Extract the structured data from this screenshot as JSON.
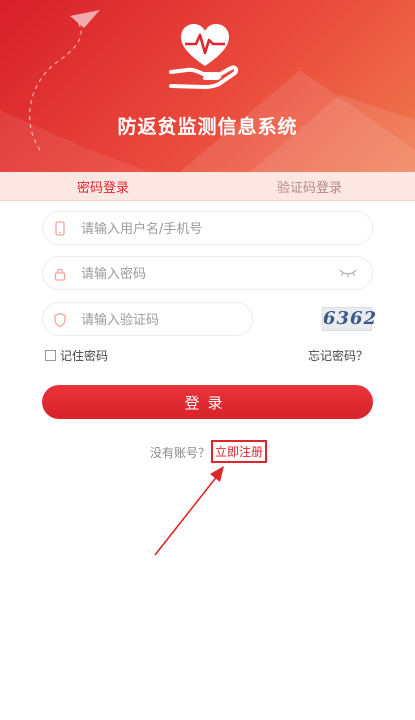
{
  "header": {
    "title": "防返贫监测信息系统",
    "logo_icon": "heart-in-hand-icon",
    "bg_colors": [
      "#d81f2a",
      "#f07a4e"
    ]
  },
  "tabs": [
    {
      "label": "密码登录",
      "active": true
    },
    {
      "label": "验证码登录",
      "active": false
    }
  ],
  "form": {
    "username_placeholder": "请输入用户名/手机号",
    "password_placeholder": "请输入密码",
    "code_placeholder": "请输入验证码",
    "captcha_text": "6362",
    "remember_label": "记住密码",
    "forgot_label": "忘记密码？",
    "login_label": "登录"
  },
  "footer": {
    "no_account_text": "没有账号？",
    "register_label": "立即注册"
  },
  "colors": {
    "accent": "#e0262d",
    "tab_bg": "#fde7e3"
  }
}
